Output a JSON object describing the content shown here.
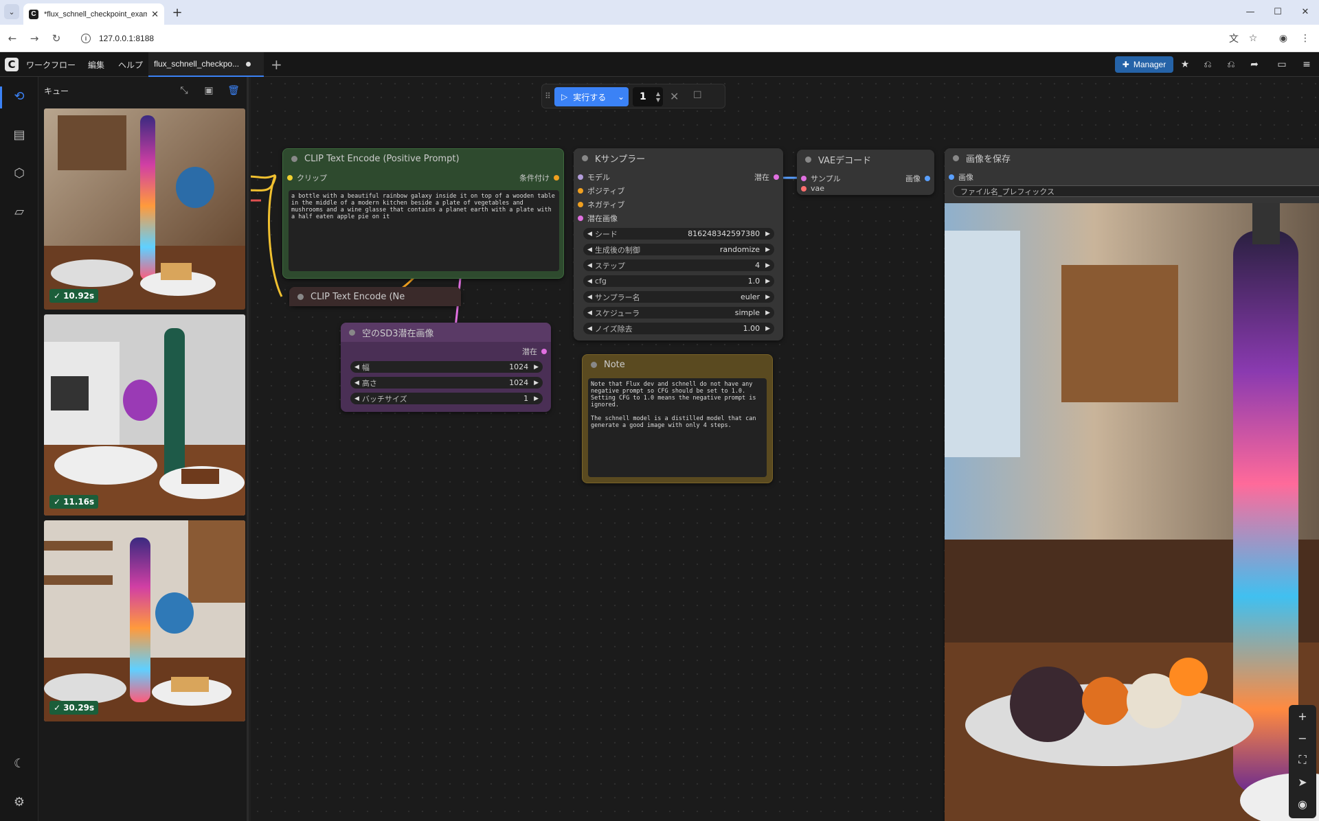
{
  "browser": {
    "tab_title": "*flux_schnell_checkpoint_examp",
    "url": "127.0.0.1:8188"
  },
  "menubar": {
    "items": [
      "ワークフロー",
      "編集",
      "ヘルプ"
    ],
    "workflow_tab": "flux_schnell_checkpo...",
    "manager_label": "Manager"
  },
  "queue": {
    "title": "キュー",
    "items": [
      {
        "time": "10.92s"
      },
      {
        "time": "11.16s"
      },
      {
        "time": "30.29s"
      }
    ]
  },
  "runbar": {
    "run_label": "実行する",
    "count": "1"
  },
  "nodes": {
    "clip_positive": {
      "title": "CLIP Text Encode (Positive Prompt)",
      "input": "クリップ",
      "output": "条件付け",
      "text": "a bottle with a beautiful rainbow galaxy inside it on top of a wooden table in the middle of a modern kitchen beside a plate of vegetables and mushrooms and a wine glasse that contains a planet earth with a plate with a half eaten apple pie on it"
    },
    "clip_negative": {
      "title": "CLIP Text Encode (Ne"
    },
    "empty_latent": {
      "title": "空のSD3潜在画像",
      "output": "潜在",
      "widgets": [
        {
          "label": "幅",
          "value": "1024"
        },
        {
          "label": "高さ",
          "value": "1024"
        },
        {
          "label": "バッチサイズ",
          "value": "1"
        }
      ]
    },
    "ksampler": {
      "title": "Kサンプラー",
      "inputs": [
        "モデル",
        "ポジティブ",
        "ネガティブ",
        "潜在画像"
      ],
      "output": "潜在",
      "widgets": [
        {
          "label": "シード",
          "value": "816248342597380"
        },
        {
          "label": "生成後の制御",
          "value": "randomize"
        },
        {
          "label": "ステップ",
          "value": "4"
        },
        {
          "label": "cfg",
          "value": "1.0"
        },
        {
          "label": "サンプラー名",
          "value": "euler"
        },
        {
          "label": "スケジューラ",
          "value": "simple"
        },
        {
          "label": "ノイズ除去",
          "value": "1.00"
        }
      ]
    },
    "vae_decode": {
      "title": "VAEデコード",
      "inputs": [
        "サンプル",
        "vae"
      ],
      "output": "画像"
    },
    "save_image": {
      "title": "画像を保存",
      "input": "画像",
      "prefix_placeholder": "ファイル名_プレフィックス"
    },
    "note": {
      "title": "Note",
      "text": "Note that Flux dev and schnell do not have any negative prompt so CFG should be set to 1.0. Setting CFG to 1.0 means the negative prompt is ignored.\n\nThe schnell model is a distilled model that can generate a good image with only 4 steps."
    }
  },
  "colors": {
    "accent": "#3b82f6",
    "clip_node": "#2f4a2f",
    "neg_node": "#3a2a2a",
    "latent_node": "#4a2f55",
    "note_node": "#5a4a20",
    "success_badge": "#1b5e3a"
  }
}
